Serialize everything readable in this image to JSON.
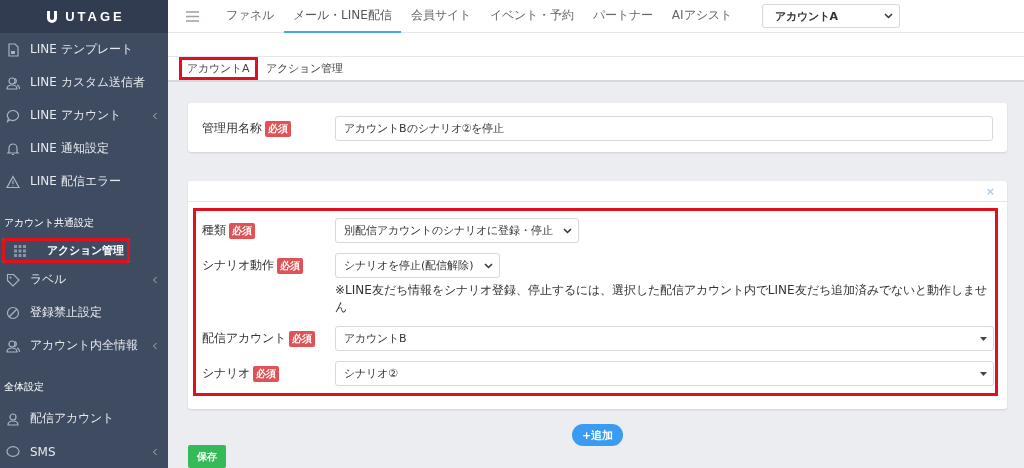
{
  "logo": {
    "text": "UTAGE"
  },
  "sidebar": {
    "items": [
      {
        "kind": "item",
        "label": "LINE テンプレート",
        "has_arrow": false,
        "selected": false,
        "highlighted": false
      },
      {
        "kind": "item",
        "label": "LINE カスタム送信者",
        "has_arrow": false,
        "selected": false,
        "highlighted": false
      },
      {
        "kind": "item",
        "label": "LINE アカウント",
        "has_arrow": true,
        "selected": false,
        "highlighted": false
      },
      {
        "kind": "item",
        "label": "LINE 通知設定",
        "has_arrow": false,
        "selected": false,
        "highlighted": false
      },
      {
        "kind": "item",
        "label": "LINE 配信エラー",
        "has_arrow": false,
        "selected": false,
        "highlighted": false
      },
      {
        "kind": "section",
        "label": "アカウント共通設定"
      },
      {
        "kind": "item",
        "label": "アクション管理",
        "has_arrow": false,
        "selected": true,
        "highlighted": true
      },
      {
        "kind": "item",
        "label": "ラベル",
        "has_arrow": true,
        "selected": false,
        "highlighted": false
      },
      {
        "kind": "item",
        "label": "登録禁止設定",
        "has_arrow": false,
        "selected": false,
        "highlighted": false
      },
      {
        "kind": "item",
        "label": "アカウント内全情報",
        "has_arrow": true,
        "selected": false,
        "highlighted": false
      },
      {
        "kind": "section",
        "label": "全体設定"
      },
      {
        "kind": "item",
        "label": "配信アカウント",
        "has_arrow": false,
        "selected": false,
        "highlighted": false
      },
      {
        "kind": "item",
        "label": "SMS",
        "has_arrow": true,
        "selected": false,
        "highlighted": false
      }
    ]
  },
  "top_nav": {
    "tabs": [
      {
        "label": "ファネル",
        "selected": false
      },
      {
        "label": "メール・LINE配信",
        "selected": true
      },
      {
        "label": "会員サイト",
        "selected": false
      },
      {
        "label": "イベント・予約",
        "selected": false
      },
      {
        "label": "パートナー",
        "selected": false
      },
      {
        "label": "AIアシスト",
        "selected": false
      }
    ],
    "account_select": {
      "value": "アカウントA"
    }
  },
  "breadcrumb": [
    {
      "label": "アカウントA",
      "highlighted": true
    },
    {
      "label": "アクション管理",
      "highlighted": false
    }
  ],
  "name_card": {
    "label": "管理用名称",
    "badge": "必須",
    "value": "アカウントBのシナリオ②を停止"
  },
  "action_card": {
    "close": "×",
    "highlighted": true,
    "rows": [
      {
        "kind": "select",
        "label": "種類",
        "badge": "必須",
        "value": "別配信アカウントのシナリオに登録・停止"
      },
      {
        "kind": "select",
        "label": "シナリオ動作",
        "badge": "必須",
        "value": "シナリオを停止(配信解除)",
        "note": "※LINE友だち情報をシナリオ登録、停止するには、選択した配信アカウント内でLINE友だち追加済みでないと動作しません"
      },
      {
        "kind": "dropdown",
        "label": "配信アカウント",
        "badge": "必須",
        "value": "アカウントB"
      },
      {
        "kind": "dropdown",
        "label": "シナリオ",
        "badge": "必須",
        "value": "シナリオ②"
      }
    ]
  },
  "add_button": "+追加",
  "save_button": "保存"
}
